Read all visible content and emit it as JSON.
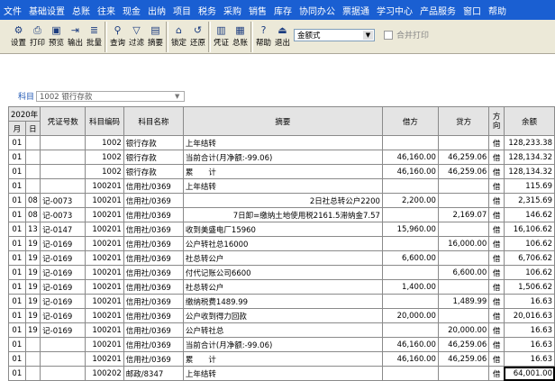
{
  "menu": [
    "文件",
    "基础设置",
    "总账",
    "往来",
    "现金",
    "出纳",
    "项目",
    "税务",
    "采购",
    "销售",
    "库存",
    "协同办公",
    "票据通",
    "学习中心",
    "产品服务",
    "窗口",
    "帮助"
  ],
  "toolbar": [
    {
      "icon": "settings-icon",
      "glyph": "⚙",
      "label": "设置"
    },
    {
      "icon": "print-icon",
      "glyph": "⎙",
      "label": "打印"
    },
    {
      "icon": "preview-icon",
      "glyph": "▣",
      "label": "预览"
    },
    {
      "icon": "export-icon",
      "glyph": "⇥",
      "label": "输出"
    },
    {
      "icon": "batch-icon",
      "glyph": "≣",
      "label": "批量"
    },
    {
      "sep": true
    },
    {
      "icon": "query-icon",
      "glyph": "⚲",
      "label": "查询"
    },
    {
      "icon": "filter-icon",
      "glyph": "▽",
      "label": "过滤"
    },
    {
      "icon": "summary-icon",
      "glyph": "▤",
      "label": "摘要"
    },
    {
      "sep": true
    },
    {
      "icon": "lock-icon",
      "glyph": "⌂",
      "label": "锁定"
    },
    {
      "icon": "restore-icon",
      "glyph": "↺",
      "label": "还原"
    },
    {
      "sep": true
    },
    {
      "icon": "voucher-icon",
      "glyph": "▥",
      "label": "凭证"
    },
    {
      "icon": "ledger-icon",
      "glyph": "▦",
      "label": "总账"
    },
    {
      "sep": true
    },
    {
      "icon": "help-icon",
      "glyph": "?",
      "label": "帮助"
    },
    {
      "icon": "exit-icon",
      "glyph": "⏏",
      "label": "退出"
    }
  ],
  "format_select": "金额式",
  "merge_print_label": "合并打印",
  "subject": {
    "label": "科目",
    "value": "1002 银行存款"
  },
  "table": {
    "year_header": "2020年",
    "month_header": "月",
    "day_header": "日",
    "columns": [
      "凭证号数",
      "科目编码",
      "科目名称",
      "摘要",
      "借方",
      "贷方",
      "方向",
      "余额"
    ],
    "direction_header": [
      "方",
      "向"
    ],
    "rows": [
      [
        "01",
        "",
        "",
        "1002",
        "银行存款",
        "上年结转",
        "",
        "",
        "借",
        "128,233.38"
      ],
      [
        "01",
        "",
        "",
        "1002",
        "银行存款",
        "当前合计(月净额:-99.06)",
        "46,160.00",
        "46,259.06",
        "借",
        "128,134.32"
      ],
      [
        "01",
        "",
        "",
        "1002",
        "银行存款",
        "累　　计",
        "46,160.00",
        "46,259.06",
        "借",
        "128,134.32"
      ],
      [
        "01",
        "",
        "",
        "100201",
        "信用社/0369",
        "上年结转",
        "",
        "",
        "借",
        "115.69"
      ],
      [
        "01",
        "08",
        "记-0073",
        "100201",
        "信用社/0369",
        "2日社总转公户2200",
        "2,200.00",
        "",
        "借",
        "2,315.69"
      ],
      [
        "01",
        "08",
        "记-0073",
        "100201",
        "信用社/0369",
        "7日卸=缴纳土地使用税2161.5滞纳金7.57",
        "",
        "2,169.07",
        "借",
        "146.62"
      ],
      [
        "01",
        "13",
        "记-0147",
        "100201",
        "信用社/0369",
        "收到美盛电厂15960",
        "15,960.00",
        "",
        "借",
        "16,106.62"
      ],
      [
        "01",
        "19",
        "记-0169",
        "100201",
        "信用社/0369",
        "公户转社总16000",
        "",
        "16,000.00",
        "借",
        "106.62"
      ],
      [
        "01",
        "19",
        "记-0169",
        "100201",
        "信用社/0369",
        "社总转公户",
        "6,600.00",
        "",
        "借",
        "6,706.62"
      ],
      [
        "01",
        "19",
        "记-0169",
        "100201",
        "信用社/0369",
        "付代记账公司6600",
        "",
        "6,600.00",
        "借",
        "106.62"
      ],
      [
        "01",
        "19",
        "记-0169",
        "100201",
        "信用社/0369",
        "社总转公户",
        "1,400.00",
        "",
        "借",
        "1,506.62"
      ],
      [
        "01",
        "19",
        "记-0169",
        "100201",
        "信用社/0369",
        "缴纳税费1489.99",
        "",
        "1,489.99",
        "借",
        "16.63"
      ],
      [
        "01",
        "19",
        "记-0169",
        "100201",
        "信用社/0369",
        "公户收到得力回款",
        "20,000.00",
        "",
        "借",
        "20,016.63"
      ],
      [
        "01",
        "19",
        "记-0169",
        "100201",
        "信用社/0369",
        "公户转社总",
        "",
        "20,000.00",
        "借",
        "16.63"
      ],
      [
        "01",
        "",
        "",
        "100201",
        "信用社/0369",
        "当前合计(月净额:-99.06)",
        "46,160.00",
        "46,259.06",
        "借",
        "16.63"
      ],
      [
        "01",
        "",
        "",
        "100201",
        "信用社/0369",
        "累　　计",
        "46,160.00",
        "46,259.06",
        "借",
        "16.63"
      ],
      [
        "01",
        "",
        "",
        "100202",
        "邮政/8347",
        "上年结转",
        "",
        "",
        "借",
        "64,001.00"
      ]
    ]
  }
}
